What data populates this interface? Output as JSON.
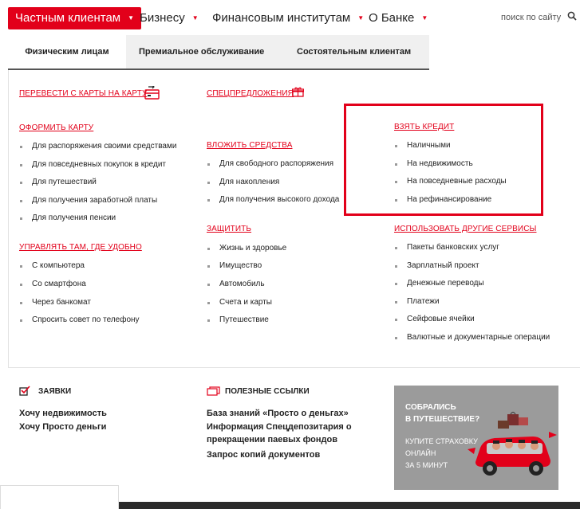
{
  "nav": {
    "items": [
      {
        "label": "Частным клиентам"
      },
      {
        "label": "Бизнесу"
      },
      {
        "label": "Финансовым институтам"
      },
      {
        "label": "О Банке"
      }
    ],
    "search": "поиск по сайту"
  },
  "subtabs": [
    "Физическим лицам",
    "Премиальное обслуживание",
    "Состоятельным клиентам"
  ],
  "col1": {
    "transfer": "ПЕРЕВЕСТИ С КАРТЫ НА КАРТУ",
    "card_heading": "ОФОРМИТЬ КАРТУ",
    "card_items": [
      "Для распоряжения своими средствами",
      "Для повседневных покупок в кредит",
      "Для путешествий",
      "Для получения заработной платы",
      "Для получения пенсии"
    ],
    "manage_heading": "УПРАВЛЯТЬ ТАМ, ГДЕ УДОБНО",
    "manage_items": [
      "С компьютера",
      "Со смартфона",
      "Через банкомат",
      "Спросить совет по телефону"
    ]
  },
  "col2": {
    "special": "СПЕЦПРЕДЛОЖЕНИЯ",
    "invest_heading": "ВЛОЖИТЬ СРЕДСТВА",
    "invest_items": [
      "Для свободного распоряжения",
      "Для накопления",
      "Для получения высокого дохода"
    ],
    "protect_heading": "ЗАЩИТИТЬ",
    "protect_items": [
      "Жизнь и здоровье",
      "Имущество",
      "Автомобиль",
      "Счета и карты",
      "Путешествие"
    ]
  },
  "col3": {
    "credit_heading": "ВЗЯТЬ КРЕДИТ",
    "credit_items": [
      "Наличными",
      "На недвижимость",
      "На повседневные расходы",
      "На рефинансирование"
    ],
    "other_heading": "ИСПОЛЬЗОВАТЬ ДРУГИЕ СЕРВИСЫ",
    "other_items": [
      "Пакеты банковских услуг",
      "Зарплатный проект",
      "Денежные переводы",
      "Платежи",
      "Сейфовые ячейки",
      "Валютные и документарные операции"
    ]
  },
  "bottom": {
    "applications_title": "ЗАЯВКИ",
    "applications": [
      "Хочу недвижимость",
      "Хочу Просто деньги"
    ],
    "links_title": "ПОЛЕЗНЫЕ ССЫЛКИ",
    "links": [
      "База знаний «Просто о деньгах»",
      "Информация Спецдепозитария о прекращении паевых фондов",
      "Запрос копий документов"
    ]
  },
  "promo": {
    "title": "СОБРАЛИСЬ\nВ ПУТЕШЕСТВИЕ?",
    "subtitle": "КУПИТЕ СТРАХОВКУ\nОНЛАЙН\nЗА 5 МИНУТ"
  },
  "colors": {
    "accent": "#e2001a",
    "promo_bg": "#9b9b9b"
  }
}
